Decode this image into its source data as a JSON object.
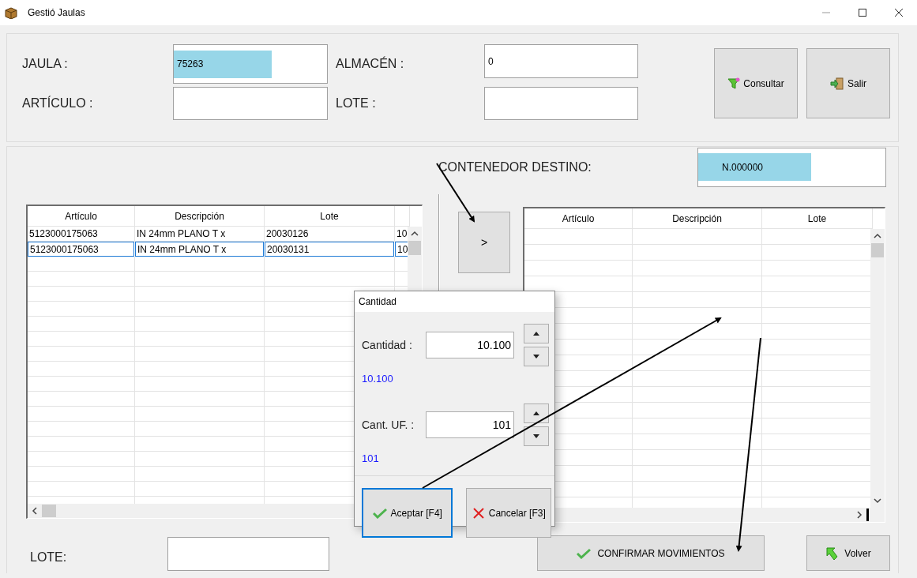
{
  "window": {
    "title": "Gestió Jaulas"
  },
  "search_fields": [
    {
      "label": "JAULA :",
      "value": "75263",
      "highlighted": true
    },
    {
      "label": "ALMACÉN :",
      "value": "0",
      "highlighted": false
    },
    {
      "label": "ARTÍCULO :",
      "highlighted": false
    },
    {
      "label": "LOTE :",
      "highlighted": false
    }
  ],
  "actions": [
    {
      "label": "Consultar",
      "kind": "filter"
    },
    {
      "label": "Salir",
      "kind": "exit"
    }
  ],
  "destination": {
    "label": "CONTENEDOR DESTINO:",
    "value": "N.000000",
    "highlighted": true
  },
  "move_button": {
    "label": ">"
  },
  "source_table": {
    "columns": [
      "Artículo",
      "Descripción",
      "Lote"
    ],
    "rows": [
      {
        "cells": [
          "5123000175063",
          "IN 24mm PLANO T x",
          "20030126",
          "10"
        ],
        "selected": false
      },
      {
        "cells": [
          "5123000175063",
          "IN 24mm PLANO T x",
          "20030131",
          "10"
        ],
        "selected": true
      }
    ]
  },
  "target_table": {
    "columns": [
      "Artículo",
      "Descripción",
      "Lote"
    ]
  },
  "lote": {
    "label": "LOTE:"
  },
  "confirm_button": {
    "label": "CONFIRMAR MOVIMIENTOS"
  },
  "back_button": {
    "label": "Volver"
  },
  "dialog": {
    "title": "Cantidad",
    "fields": [
      {
        "label": "Cantidad :",
        "value": "10.100",
        "note": "10.100"
      },
      {
        "label": "Cant. UF. :",
        "value": "101",
        "note": "101"
      }
    ],
    "buttons": [
      {
        "label": "Aceptar [F4]",
        "kind": "accept",
        "focused": true
      },
      {
        "label": "Cancelar [F3]",
        "kind": "cancel",
        "focused": false
      }
    ]
  }
}
